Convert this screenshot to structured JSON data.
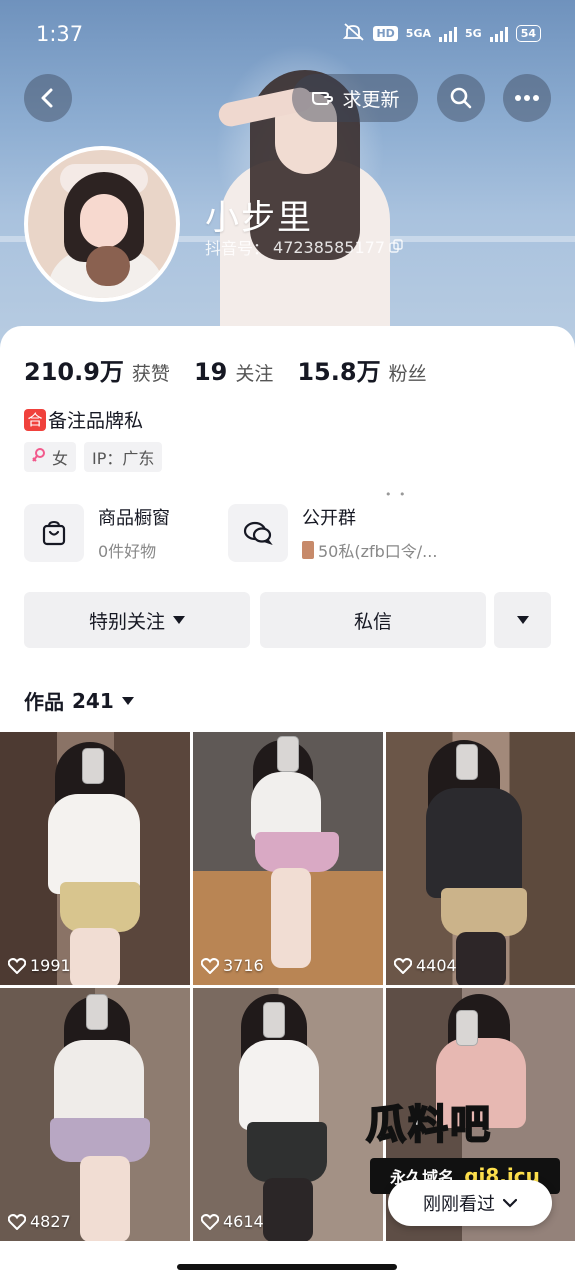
{
  "status_bar": {
    "time": "1:37",
    "hd_label": "HD",
    "network_1": "5GA",
    "network_2": "5G",
    "battery": "54"
  },
  "nav": {
    "back_icon": "chevron-left-icon",
    "update_label": "求更新",
    "search_icon": "search-icon",
    "more_icon": "more-icon"
  },
  "profile": {
    "name": "小步里",
    "douyin_id_label": "抖音号：",
    "douyin_id": "47238585177"
  },
  "stats": [
    {
      "value": "210.9万",
      "label": "获赞"
    },
    {
      "value": "19",
      "label": "关注"
    },
    {
      "value": "15.8万",
      "label": "粉丝"
    }
  ],
  "bio": {
    "emoji_char": "合",
    "text": "备注品牌私"
  },
  "tags": {
    "gender": "女",
    "ip": "IP：广东"
  },
  "faint_dots": "• •",
  "services": {
    "shop": {
      "title": "商品橱窗",
      "subtitle": "0件好物"
    },
    "group": {
      "title": "公开群",
      "subtitle": "50私(zfb口令/..."
    }
  },
  "actions": {
    "special_follow": "特别关注",
    "message": "私信"
  },
  "works": {
    "label": "作品",
    "count": "241"
  },
  "videos": [
    {
      "likes": "1991"
    },
    {
      "likes": "3716"
    },
    {
      "likes": "4404"
    },
    {
      "likes": "4827"
    },
    {
      "likes": "4614"
    }
  ],
  "watermark": {
    "title": "瓜料吧",
    "label": "永久域名",
    "domain": "gi8.icu"
  },
  "recent_pill": "刚刚看过",
  "colors": {
    "banner": "#8eaed2",
    "accent_red": "#f0413c",
    "button_bg": "#f0f0f2"
  }
}
